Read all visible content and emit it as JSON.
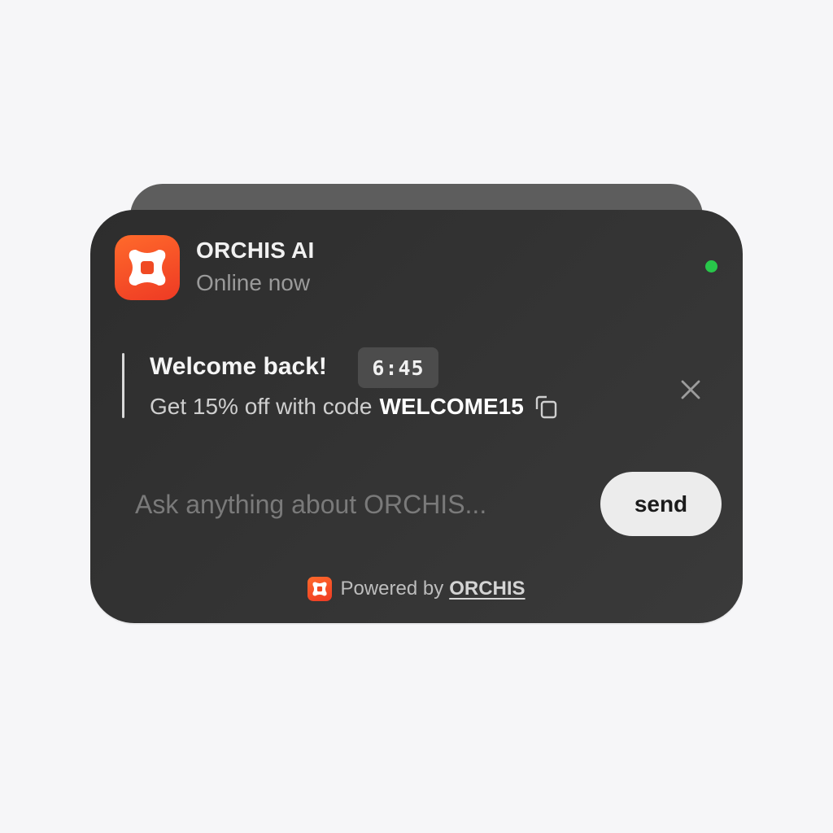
{
  "header": {
    "app_name": "ORCHIS AI",
    "status": "Online now",
    "status_color": "#28c74a",
    "logo_icon": "orchis-logo-icon",
    "brand_color": "#f04a24"
  },
  "notice": {
    "title": "Welcome back!",
    "timer": "6:45",
    "text": "Get 15% off with code",
    "code": "WELCOME15",
    "copy_icon": "copy-icon",
    "close_icon": "close-icon"
  },
  "chat": {
    "placeholder": "Ask anything about ORCHIS...",
    "value": "",
    "send_label": "send"
  },
  "footer": {
    "prefix": "Powered by",
    "link": "ORCHIS"
  }
}
